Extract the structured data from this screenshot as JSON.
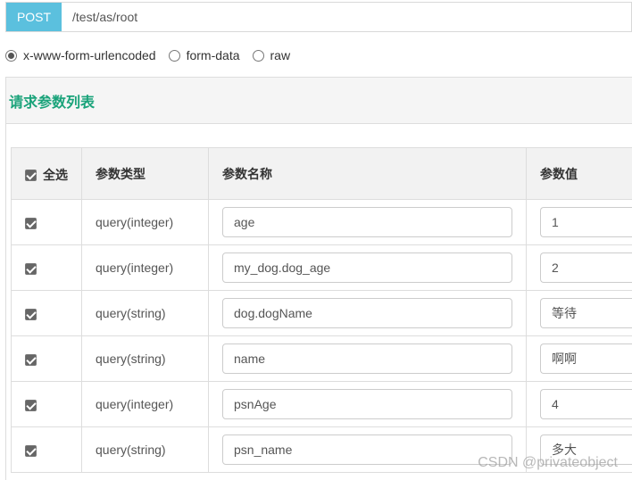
{
  "request": {
    "method": "POST",
    "url": "/test/as/root"
  },
  "body_type": {
    "options": [
      {
        "label": "x-www-form-urlencoded",
        "checked": true
      },
      {
        "label": "form-data",
        "checked": false
      },
      {
        "label": "raw",
        "checked": false
      }
    ]
  },
  "panel": {
    "title": "请求参数列表"
  },
  "table": {
    "headers": {
      "select_all": "全选",
      "type": "参数类型",
      "name": "参数名称",
      "value": "参数值"
    },
    "rows": [
      {
        "checked": true,
        "type": "query(integer)",
        "name": "age",
        "value": "1"
      },
      {
        "checked": true,
        "type": "query(integer)",
        "name": "my_dog.dog_age",
        "value": "2"
      },
      {
        "checked": true,
        "type": "query(string)",
        "name": "dog.dogName",
        "value": "等待"
      },
      {
        "checked": true,
        "type": "query(string)",
        "name": "name",
        "value": "啊啊"
      },
      {
        "checked": true,
        "type": "query(integer)",
        "name": "psnAge",
        "value": "4"
      },
      {
        "checked": true,
        "type": "query(string)",
        "name": "psn_name",
        "value": "多大"
      }
    ]
  },
  "watermark": "CSDN @privateobject",
  "colors": {
    "method_button": "#5bc0de",
    "panel_title": "#1aa37a"
  }
}
